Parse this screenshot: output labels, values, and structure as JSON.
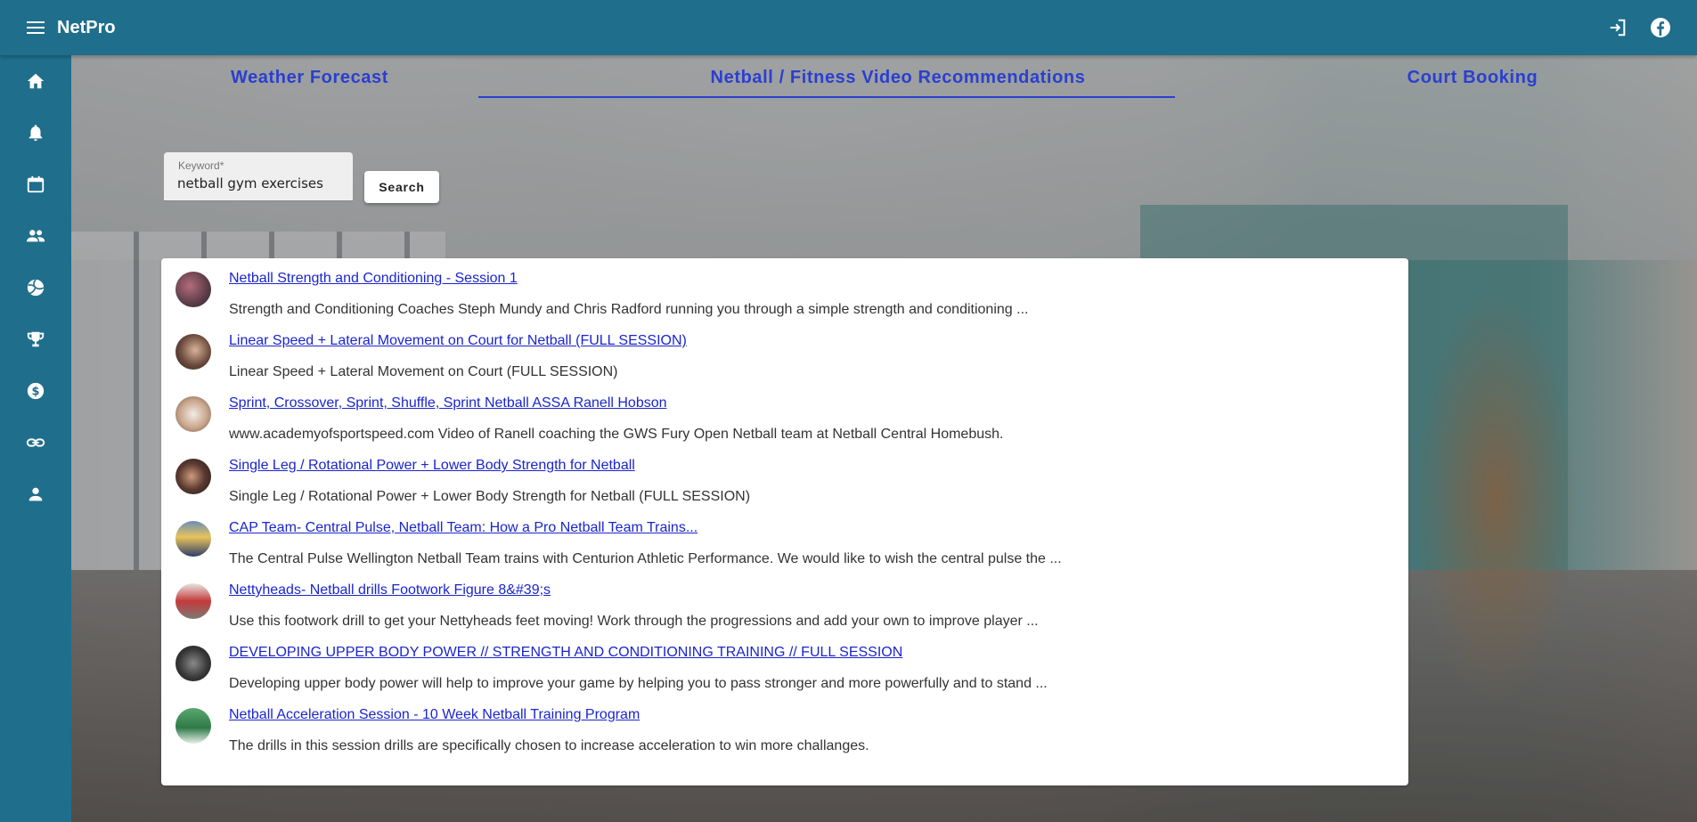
{
  "app": {
    "title": "NetPro"
  },
  "appbar": {
    "menu_icon": "menu-icon",
    "right_icons": [
      "login-icon",
      "facebook-icon"
    ]
  },
  "sidebar": {
    "items": [
      {
        "icon": "home-icon"
      },
      {
        "icon": "notifications-icon"
      },
      {
        "icon": "calendar-icon"
      },
      {
        "icon": "people-icon"
      },
      {
        "icon": "volleyball-icon"
      },
      {
        "icon": "trophy-icon"
      },
      {
        "icon": "dollar-icon"
      },
      {
        "icon": "link-icon"
      },
      {
        "icon": "person-icon"
      }
    ]
  },
  "tabs": [
    {
      "label": "Weather Forecast"
    },
    {
      "label": "Netball / Fitness Video Recommendations",
      "active": true
    },
    {
      "label": "Court Booking"
    }
  ],
  "search": {
    "label": "Keyword*",
    "value": "netball gym exercises",
    "button_label": "Search"
  },
  "results": [
    {
      "title": "Netball Strength and Conditioning - Session 1",
      "description": "Strength and Conditioning Coaches Steph Mundy and Chris Radford running you through a simple strength and conditioning ..."
    },
    {
      "title": "Linear Speed + Lateral Movement on Court for Netball (FULL SESSION)",
      "description": "Linear Speed + Lateral Movement on Court (FULL SESSION)"
    },
    {
      "title": "Sprint, Crossover, Sprint, Shuffle, Sprint Netball ASSA Ranell Hobson",
      "description": "www.academyofsportspeed.com Video of Ranell coaching the GWS Fury Open Netball team at Netball Central Homebush."
    },
    {
      "title": "Single Leg / Rotational Power + Lower Body Strength for Netball",
      "description": "Single Leg / Rotational Power + Lower Body Strength for Netball (FULL SESSION)"
    },
    {
      "title": "CAP Team- Central Pulse, Netball Team: How a Pro Netball Team Trains...",
      "description": "The Central Pulse Wellington Netball Team trains with Centurion Athletic Performance. We would like to wish the central pulse the ..."
    },
    {
      "title": "Nettyheads- Netball drills Footwork Figure 8&#39;s",
      "description": "Use this footwork drill to get your Nettyheads feet moving! Work through the progressions and add your own to improve player ..."
    },
    {
      "title": "DEVELOPING UPPER BODY POWER // STRENGTH AND CONDITIONING TRAINING // FULL SESSION",
      "description": "Developing upper body power will help to improve your game by helping you to pass stronger and more powerfully and to stand ..."
    },
    {
      "title": "Netball Acceleration Session - 10 Week Netball Training Program",
      "description": "The drills in this session drills are specifically chosen to increase acceleration to win more challanges."
    }
  ],
  "colors": {
    "primary": "#1f6e8c",
    "tab_text": "#2a3fd0",
    "link": "#1a25cc"
  }
}
